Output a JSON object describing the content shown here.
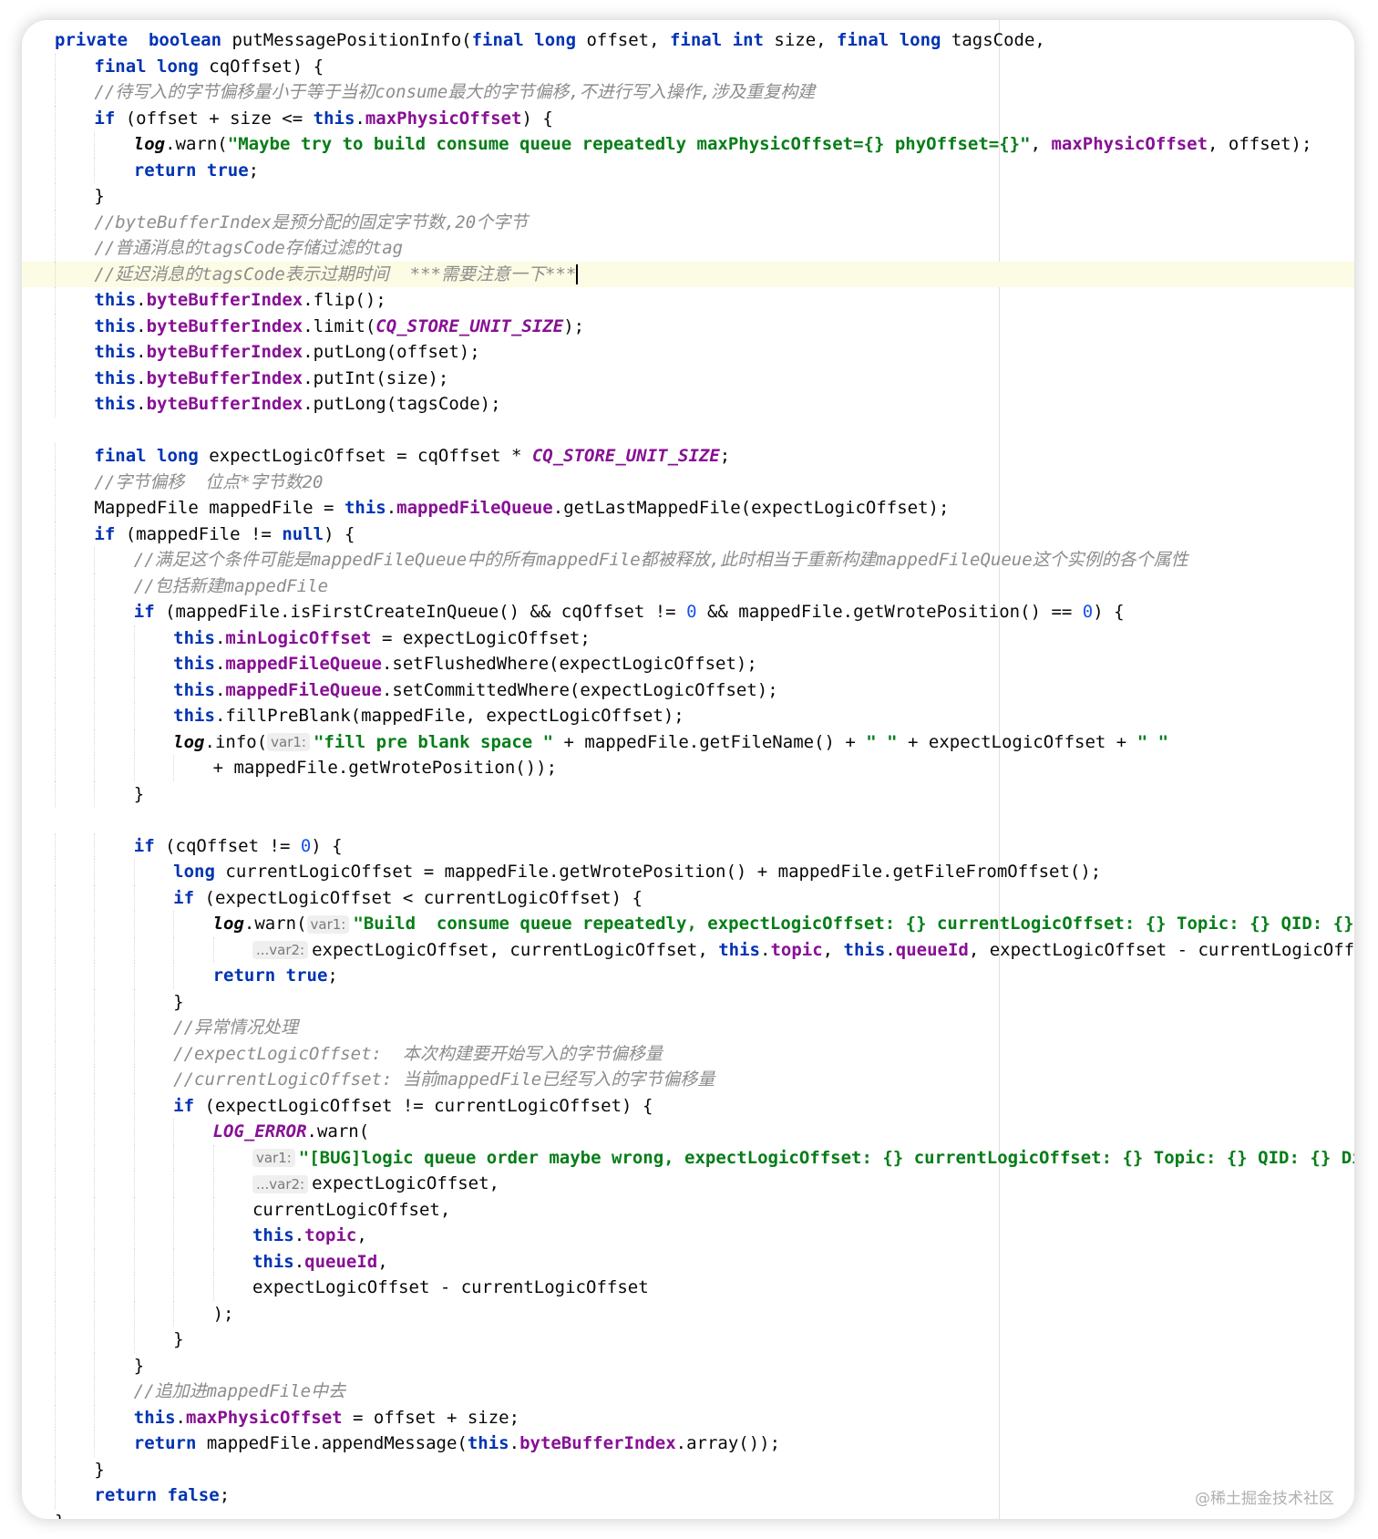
{
  "editor": {
    "watermark": "@稀土掘金技术社区",
    "lines": [
      {
        "n": 0,
        "t": [
          [
            "kw",
            "private"
          ],
          [
            "",
            "  "
          ],
          [
            "kw",
            "boolean"
          ],
          [
            "",
            " putMessagePositionInfo("
          ],
          [
            "kw",
            "final"
          ],
          [
            "",
            " "
          ],
          [
            "kw",
            "long"
          ],
          [
            "",
            " offset, "
          ],
          [
            "kw",
            "final"
          ],
          [
            "",
            " "
          ],
          [
            "kw",
            "int"
          ],
          [
            "",
            " size, "
          ],
          [
            "kw",
            "final"
          ],
          [
            "",
            " "
          ],
          [
            "kw",
            "long"
          ],
          [
            "",
            " tagsCode,"
          ]
        ]
      },
      {
        "n": 1,
        "t": [
          [
            "kw",
            "final"
          ],
          [
            "",
            " "
          ],
          [
            "kw",
            "long"
          ],
          [
            "",
            " cqOffset) {"
          ]
        ]
      },
      {
        "n": 1,
        "t": [
          [
            "cm",
            "//待写入的字节偏移量小于等于当初consume最大的字节偏移,不进行写入操作,涉及重复构建"
          ]
        ]
      },
      {
        "n": 1,
        "t": [
          [
            "kw",
            "if"
          ],
          [
            "",
            " (offset + size <= "
          ],
          [
            "kw",
            "this"
          ],
          [
            "",
            "."
          ],
          [
            "fld",
            "maxPhysicOffset"
          ],
          [
            "",
            ") {"
          ]
        ]
      },
      {
        "n": 2,
        "t": [
          [
            "log",
            "log"
          ],
          [
            "",
            ".warn("
          ],
          [
            "str",
            "\"Maybe try to build consume queue repeatedly maxPhysicOffset={} phyOffset={}\""
          ],
          [
            "",
            ", "
          ],
          [
            "fld",
            "maxPhysicOffset"
          ],
          [
            "",
            ", offset);"
          ]
        ]
      },
      {
        "n": 2,
        "t": [
          [
            "kw",
            "return"
          ],
          [
            "",
            " "
          ],
          [
            "kw",
            "true"
          ],
          [
            "",
            ";"
          ]
        ]
      },
      {
        "n": 1,
        "t": [
          [
            "",
            "}"
          ]
        ]
      },
      {
        "n": 1,
        "t": [
          [
            "cm",
            "//byteBufferIndex是预分配的固定字节数,20个字节"
          ]
        ]
      },
      {
        "n": 1,
        "t": [
          [
            "cm",
            "//普通消息的tagsCode存储过滤的tag"
          ]
        ]
      },
      {
        "n": 1,
        "cur": true,
        "t": [
          [
            "cm",
            "//延迟消息的tagsCode表示过期时间  ***需要注意一下***"
          ]
        ]
      },
      {
        "n": 1,
        "t": [
          [
            "kw",
            "this"
          ],
          [
            "",
            "."
          ],
          [
            "fld",
            "byteBufferIndex"
          ],
          [
            "",
            ".flip();"
          ]
        ]
      },
      {
        "n": 1,
        "t": [
          [
            "kw",
            "this"
          ],
          [
            "",
            "."
          ],
          [
            "fld",
            "byteBufferIndex"
          ],
          [
            "",
            ".limit("
          ],
          [
            "st",
            "CQ_STORE_UNIT_SIZE"
          ],
          [
            "",
            ");"
          ]
        ]
      },
      {
        "n": 1,
        "t": [
          [
            "kw",
            "this"
          ],
          [
            "",
            "."
          ],
          [
            "fld",
            "byteBufferIndex"
          ],
          [
            "",
            ".putLong(offset);"
          ]
        ]
      },
      {
        "n": 1,
        "t": [
          [
            "kw",
            "this"
          ],
          [
            "",
            "."
          ],
          [
            "fld",
            "byteBufferIndex"
          ],
          [
            "",
            ".putInt(size);"
          ]
        ]
      },
      {
        "n": 1,
        "t": [
          [
            "kw",
            "this"
          ],
          [
            "",
            "."
          ],
          [
            "fld",
            "byteBufferIndex"
          ],
          [
            "",
            ".putLong(tagsCode);"
          ]
        ]
      },
      {
        "n": 0,
        "t": []
      },
      {
        "n": 1,
        "t": [
          [
            "kw",
            "final"
          ],
          [
            "",
            " "
          ],
          [
            "kw",
            "long"
          ],
          [
            "",
            " expectLogicOffset = cqOffset * "
          ],
          [
            "st",
            "CQ_STORE_UNIT_SIZE"
          ],
          [
            "",
            ";"
          ]
        ]
      },
      {
        "n": 1,
        "t": [
          [
            "cm",
            "//字节偏移  位点*字节数20"
          ]
        ]
      },
      {
        "n": 1,
        "t": [
          [
            "",
            "MappedFile mappedFile = "
          ],
          [
            "kw",
            "this"
          ],
          [
            "",
            "."
          ],
          [
            "fld",
            "mappedFileQueue"
          ],
          [
            "",
            ".getLastMappedFile(expectLogicOffset);"
          ]
        ]
      },
      {
        "n": 1,
        "t": [
          [
            "kw",
            "if"
          ],
          [
            "",
            " (mappedFile != "
          ],
          [
            "kw",
            "null"
          ],
          [
            "",
            ") {"
          ]
        ]
      },
      {
        "n": 2,
        "t": [
          [
            "cm",
            "//满足这个条件可能是mappedFileQueue中的所有mappedFile都被释放,此时相当于重新构建mappedFileQueue这个实例的各个属性"
          ]
        ]
      },
      {
        "n": 2,
        "t": [
          [
            "cm",
            "//包括新建mappedFile"
          ]
        ]
      },
      {
        "n": 2,
        "t": [
          [
            "kw",
            "if"
          ],
          [
            "",
            " (mappedFile.isFirstCreateInQueue() && cqOffset != "
          ],
          [
            "num",
            "0"
          ],
          [
            "",
            " && mappedFile.getWrotePosition() == "
          ],
          [
            "num",
            "0"
          ],
          [
            "",
            ") {"
          ]
        ]
      },
      {
        "n": 3,
        "t": [
          [
            "kw",
            "this"
          ],
          [
            "",
            "."
          ],
          [
            "fld",
            "minLogicOffset"
          ],
          [
            "",
            " = expectLogicOffset;"
          ]
        ]
      },
      {
        "n": 3,
        "t": [
          [
            "kw",
            "this"
          ],
          [
            "",
            "."
          ],
          [
            "fld",
            "mappedFileQueue"
          ],
          [
            "",
            ".setFlushedWhere(expectLogicOffset);"
          ]
        ]
      },
      {
        "n": 3,
        "t": [
          [
            "kw",
            "this"
          ],
          [
            "",
            "."
          ],
          [
            "fld",
            "mappedFileQueue"
          ],
          [
            "",
            ".setCommittedWhere(expectLogicOffset);"
          ]
        ]
      },
      {
        "n": 3,
        "t": [
          [
            "kw",
            "this"
          ],
          [
            "",
            ".fillPreBlank(mappedFile, expectLogicOffset);"
          ]
        ]
      },
      {
        "n": 3,
        "t": [
          [
            "log",
            "log"
          ],
          [
            "",
            ".info("
          ],
          [
            "hint",
            "var1:"
          ],
          [
            "str",
            "\"fill pre blank space \""
          ],
          [
            "",
            " + mappedFile.getFileName() + "
          ],
          [
            "str",
            "\" \""
          ],
          [
            "",
            " + expectLogicOffset + "
          ],
          [
            "str",
            "\" \""
          ]
        ]
      },
      {
        "n": 4,
        "t": [
          [
            "",
            "+ mappedFile.getWrotePosition());"
          ]
        ]
      },
      {
        "n": 2,
        "t": [
          [
            "",
            "}"
          ]
        ]
      },
      {
        "n": 0,
        "t": []
      },
      {
        "n": 2,
        "t": [
          [
            "kw",
            "if"
          ],
          [
            "",
            " (cqOffset != "
          ],
          [
            "num",
            "0"
          ],
          [
            "",
            ") {"
          ]
        ]
      },
      {
        "n": 3,
        "t": [
          [
            "kw",
            "long"
          ],
          [
            "",
            " currentLogicOffset = mappedFile.getWrotePosition() + mappedFile.getFileFromOffset();"
          ]
        ]
      },
      {
        "n": 3,
        "t": [
          [
            "kw",
            "if"
          ],
          [
            "",
            " (expectLogicOffset < currentLogicOffset) {"
          ]
        ]
      },
      {
        "n": 4,
        "t": [
          [
            "log",
            "log"
          ],
          [
            "",
            ".warn("
          ],
          [
            "hint",
            "var1:"
          ],
          [
            "str",
            "\"Build  consume queue repeatedly, expectLogicOffset: {} currentLogicOffset: {} Topic: {} QID: {} Diff: {}\""
          ]
        ]
      },
      {
        "n": 5,
        "t": [
          [
            "hint",
            "...var2:"
          ],
          [
            "",
            "expectLogicOffset, currentLogicOffset, "
          ],
          [
            "kw",
            "this"
          ],
          [
            "",
            "."
          ],
          [
            "fld",
            "topic"
          ],
          [
            "",
            ", "
          ],
          [
            "kw",
            "this"
          ],
          [
            "",
            "."
          ],
          [
            "fld",
            "queueId"
          ],
          [
            "",
            ", expectLogicOffset - currentLogicOffset);"
          ]
        ]
      },
      {
        "n": 4,
        "t": [
          [
            "kw",
            "return"
          ],
          [
            "",
            " "
          ],
          [
            "kw",
            "true"
          ],
          [
            "",
            ";"
          ]
        ]
      },
      {
        "n": 3,
        "t": [
          [
            "",
            "}"
          ]
        ]
      },
      {
        "n": 3,
        "t": [
          [
            "cm",
            "//异常情况处理"
          ]
        ]
      },
      {
        "n": 3,
        "t": [
          [
            "cm",
            "//expectLogicOffset:  本次构建要开始写入的字节偏移量"
          ]
        ]
      },
      {
        "n": 3,
        "t": [
          [
            "cm",
            "//currentLogicOffset: 当前mappedFile已经写入的字节偏移量"
          ]
        ]
      },
      {
        "n": 3,
        "t": [
          [
            "kw",
            "if"
          ],
          [
            "",
            " (expectLogicOffset != currentLogicOffset) {"
          ]
        ]
      },
      {
        "n": 4,
        "t": [
          [
            "st",
            "LOG_ERROR"
          ],
          [
            "",
            ".warn("
          ]
        ]
      },
      {
        "n": 5,
        "t": [
          [
            "hint",
            "var1:"
          ],
          [
            "str",
            "\"[BUG]logic queue order maybe wrong, expectLogicOffset: {} currentLogicOffset: {} Topic: {} QID: {} Diff: {}\","
          ]
        ]
      },
      {
        "n": 5,
        "t": [
          [
            "hint",
            "...var2:"
          ],
          [
            "",
            "expectLogicOffset,"
          ]
        ]
      },
      {
        "n": 5,
        "t": [
          [
            "",
            "currentLogicOffset,"
          ]
        ]
      },
      {
        "n": 5,
        "t": [
          [
            "kw",
            "this"
          ],
          [
            "",
            "."
          ],
          [
            "fld",
            "topic"
          ],
          [
            "",
            ","
          ]
        ]
      },
      {
        "n": 5,
        "t": [
          [
            "kw",
            "this"
          ],
          [
            "",
            "."
          ],
          [
            "fld",
            "queueId"
          ],
          [
            "",
            ","
          ]
        ]
      },
      {
        "n": 5,
        "t": [
          [
            "",
            "expectLogicOffset - currentLogicOffset"
          ]
        ]
      },
      {
        "n": 4,
        "t": [
          [
            "",
            ");"
          ]
        ]
      },
      {
        "n": 3,
        "t": [
          [
            "",
            "}"
          ]
        ]
      },
      {
        "n": 2,
        "t": [
          [
            "",
            "}"
          ]
        ]
      },
      {
        "n": 2,
        "t": [
          [
            "cm",
            "//追加进mappedFile中去"
          ]
        ]
      },
      {
        "n": 2,
        "t": [
          [
            "kw",
            "this"
          ],
          [
            "",
            "."
          ],
          [
            "fld",
            "maxPhysicOffset"
          ],
          [
            "",
            " = offset + size;"
          ]
        ]
      },
      {
        "n": 2,
        "t": [
          [
            "kw",
            "return"
          ],
          [
            "",
            " mappedFile.appendMessage("
          ],
          [
            "kw",
            "this"
          ],
          [
            "",
            "."
          ],
          [
            "fld",
            "byteBufferIndex"
          ],
          [
            "",
            ".array());"
          ]
        ]
      },
      {
        "n": 1,
        "t": [
          [
            "",
            "}"
          ]
        ]
      },
      {
        "n": 1,
        "t": [
          [
            "kw",
            "return"
          ],
          [
            "",
            " "
          ],
          [
            "kw",
            "false"
          ],
          [
            "",
            ";"
          ]
        ]
      },
      {
        "n": 0,
        "t": [
          [
            "",
            "}"
          ]
        ]
      }
    ]
  }
}
